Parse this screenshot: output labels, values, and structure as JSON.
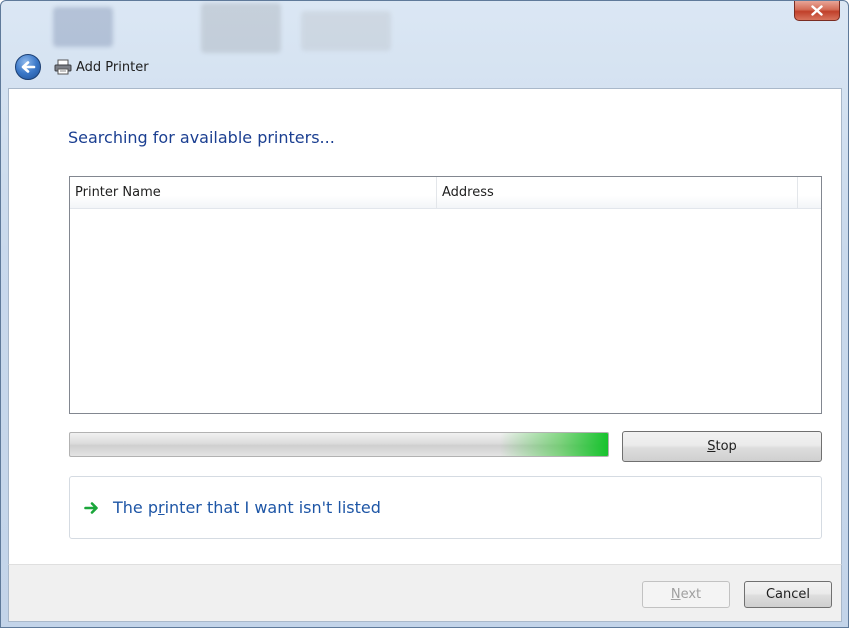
{
  "window": {
    "title": "Add Printer",
    "close_icon": "close-x-icon",
    "back_icon": "back-arrow-icon",
    "title_icon": "printer-icon"
  },
  "main": {
    "heading": "Searching for available printers...",
    "list": {
      "columns": [
        "Printer Name",
        "Address"
      ],
      "rows": []
    },
    "progress": {
      "state": "marquee",
      "accent": "#12c22a"
    },
    "stop_button": {
      "prefix": "",
      "accel": "S",
      "rest": "top"
    },
    "not_listed_link": {
      "icon": "green-arrow-icon",
      "before": "The p",
      "accel": "r",
      "after": "inter that I want isn't listed"
    }
  },
  "footer": {
    "next_button": {
      "accel": "N",
      "rest": "ext",
      "enabled": false
    },
    "cancel_button": {
      "label": "Cancel"
    }
  }
}
